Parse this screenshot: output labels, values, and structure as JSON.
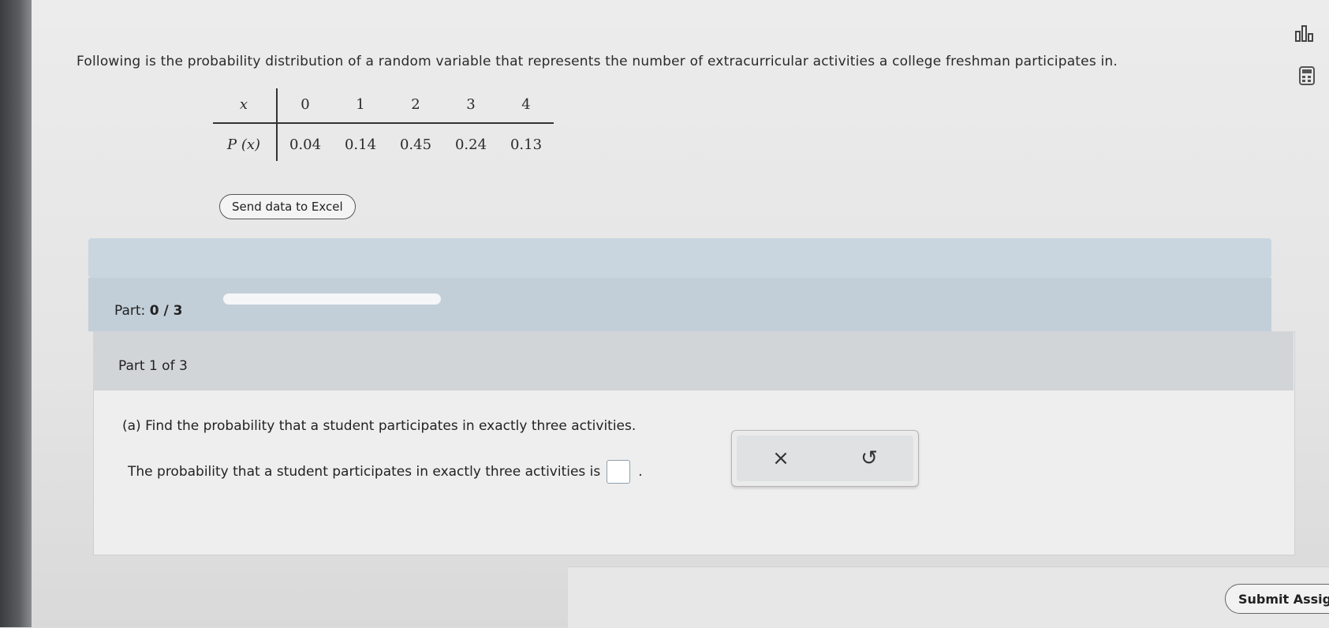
{
  "question": {
    "intro": "Following is the probability distribution of a random variable that represents the number of extracurricular activities a college freshman participates in."
  },
  "table": {
    "x_label": "x",
    "p_label": "P (x)",
    "x_values": [
      "0",
      "1",
      "2",
      "3",
      "4"
    ],
    "p_values": [
      "0.04",
      "0.14",
      "0.45",
      "0.24",
      "0.13"
    ]
  },
  "buttons": {
    "send_excel": "Send data to Excel",
    "submit": "Submit Assig",
    "clear": "×",
    "undo": "↺"
  },
  "progress": {
    "part_label": "Part:",
    "part_value": "0 / 3",
    "fraction": 0
  },
  "part": {
    "title": "Part 1 of 3",
    "question_a": "(a) Find the probability that a student participates in exactly three activities.",
    "answer_prefix": "The probability that a student participates in exactly three activities is",
    "answer_suffix": ".",
    "answer_value": ""
  },
  "icons": {
    "chart": "bar-chart-icon",
    "calculator": "calculator-icon"
  }
}
